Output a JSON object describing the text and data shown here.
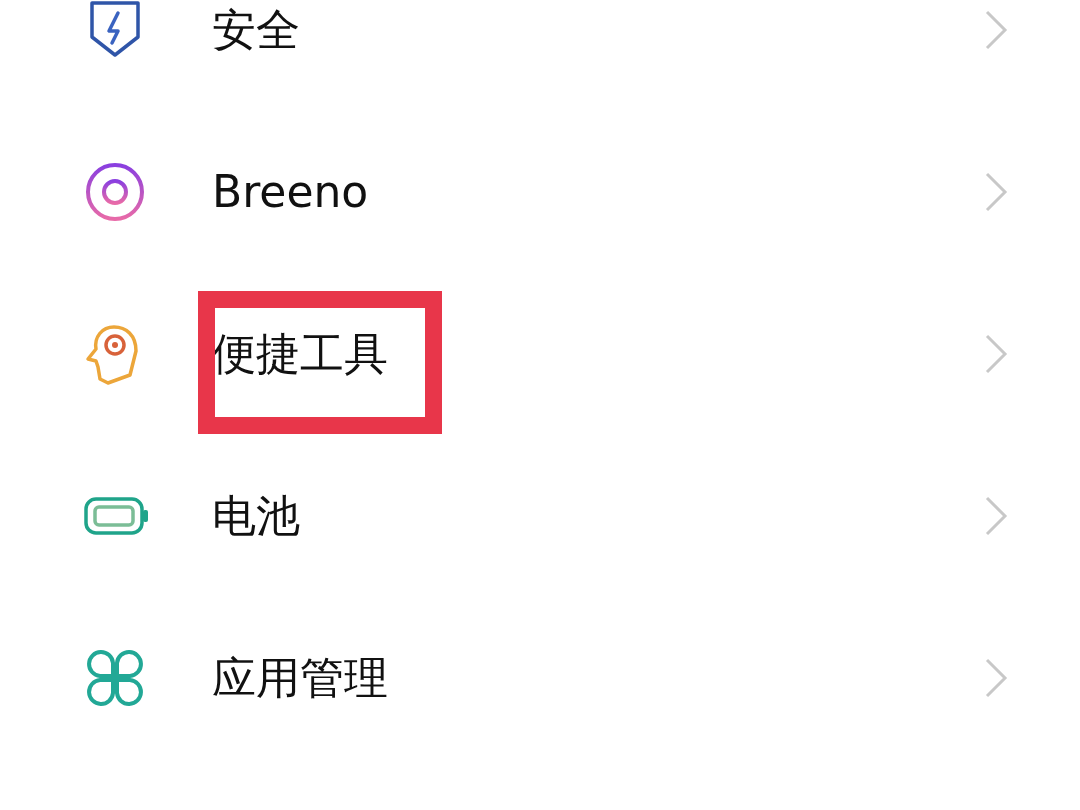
{
  "settings_list": [
    {
      "label": "安全",
      "highlighted": false
    },
    {
      "label": "Breeno",
      "highlighted": false
    },
    {
      "label": "便捷工具",
      "highlighted": true
    },
    {
      "label": "电池",
      "highlighted": false
    },
    {
      "label": "应用管理",
      "highlighted": false
    }
  ]
}
